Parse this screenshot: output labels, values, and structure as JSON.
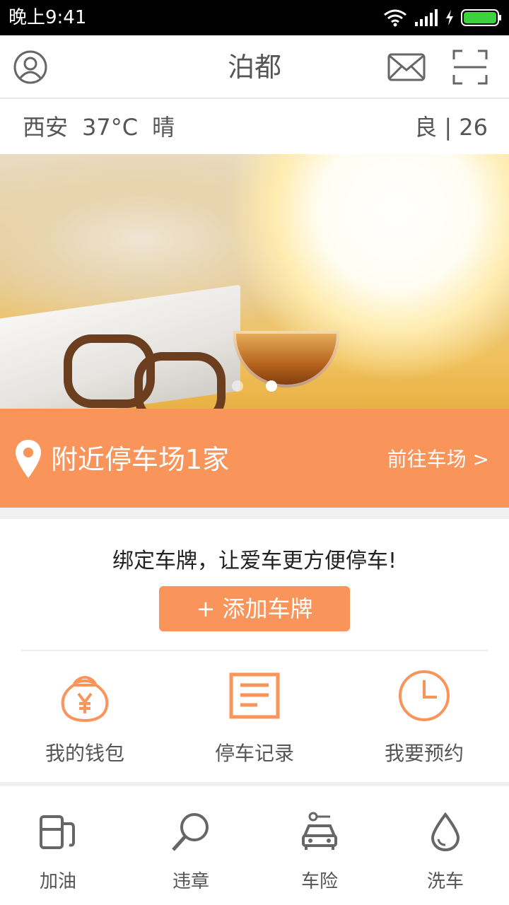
{
  "status_bar": {
    "time": "晚上9:41"
  },
  "header": {
    "title": "泊都"
  },
  "weather": {
    "city": "西安",
    "temperature": "37°C",
    "condition": "晴",
    "air_quality": "良 | 26"
  },
  "banner": {
    "slide_count": 2,
    "active_slide": 1
  },
  "nearby": {
    "label": "附近停车场1家",
    "action": "前往车场 >"
  },
  "plate": {
    "prompt": "绑定车牌，让爱车更方便停车!",
    "button": "+ 添加车牌"
  },
  "functions": [
    {
      "icon": "money-bag-icon",
      "label": "我的钱包"
    },
    {
      "icon": "document-icon",
      "label": "停车记录"
    },
    {
      "icon": "clock-icon",
      "label": "我要预约"
    }
  ],
  "tabs": [
    {
      "icon": "fuel-icon",
      "label": "加油"
    },
    {
      "icon": "search-icon",
      "label": "违章"
    },
    {
      "icon": "car-icon",
      "label": "车险"
    },
    {
      "icon": "water-drop-icon",
      "label": "洗车"
    }
  ],
  "colors": {
    "accent": "#f9945b",
    "icon_gray": "#666666"
  }
}
